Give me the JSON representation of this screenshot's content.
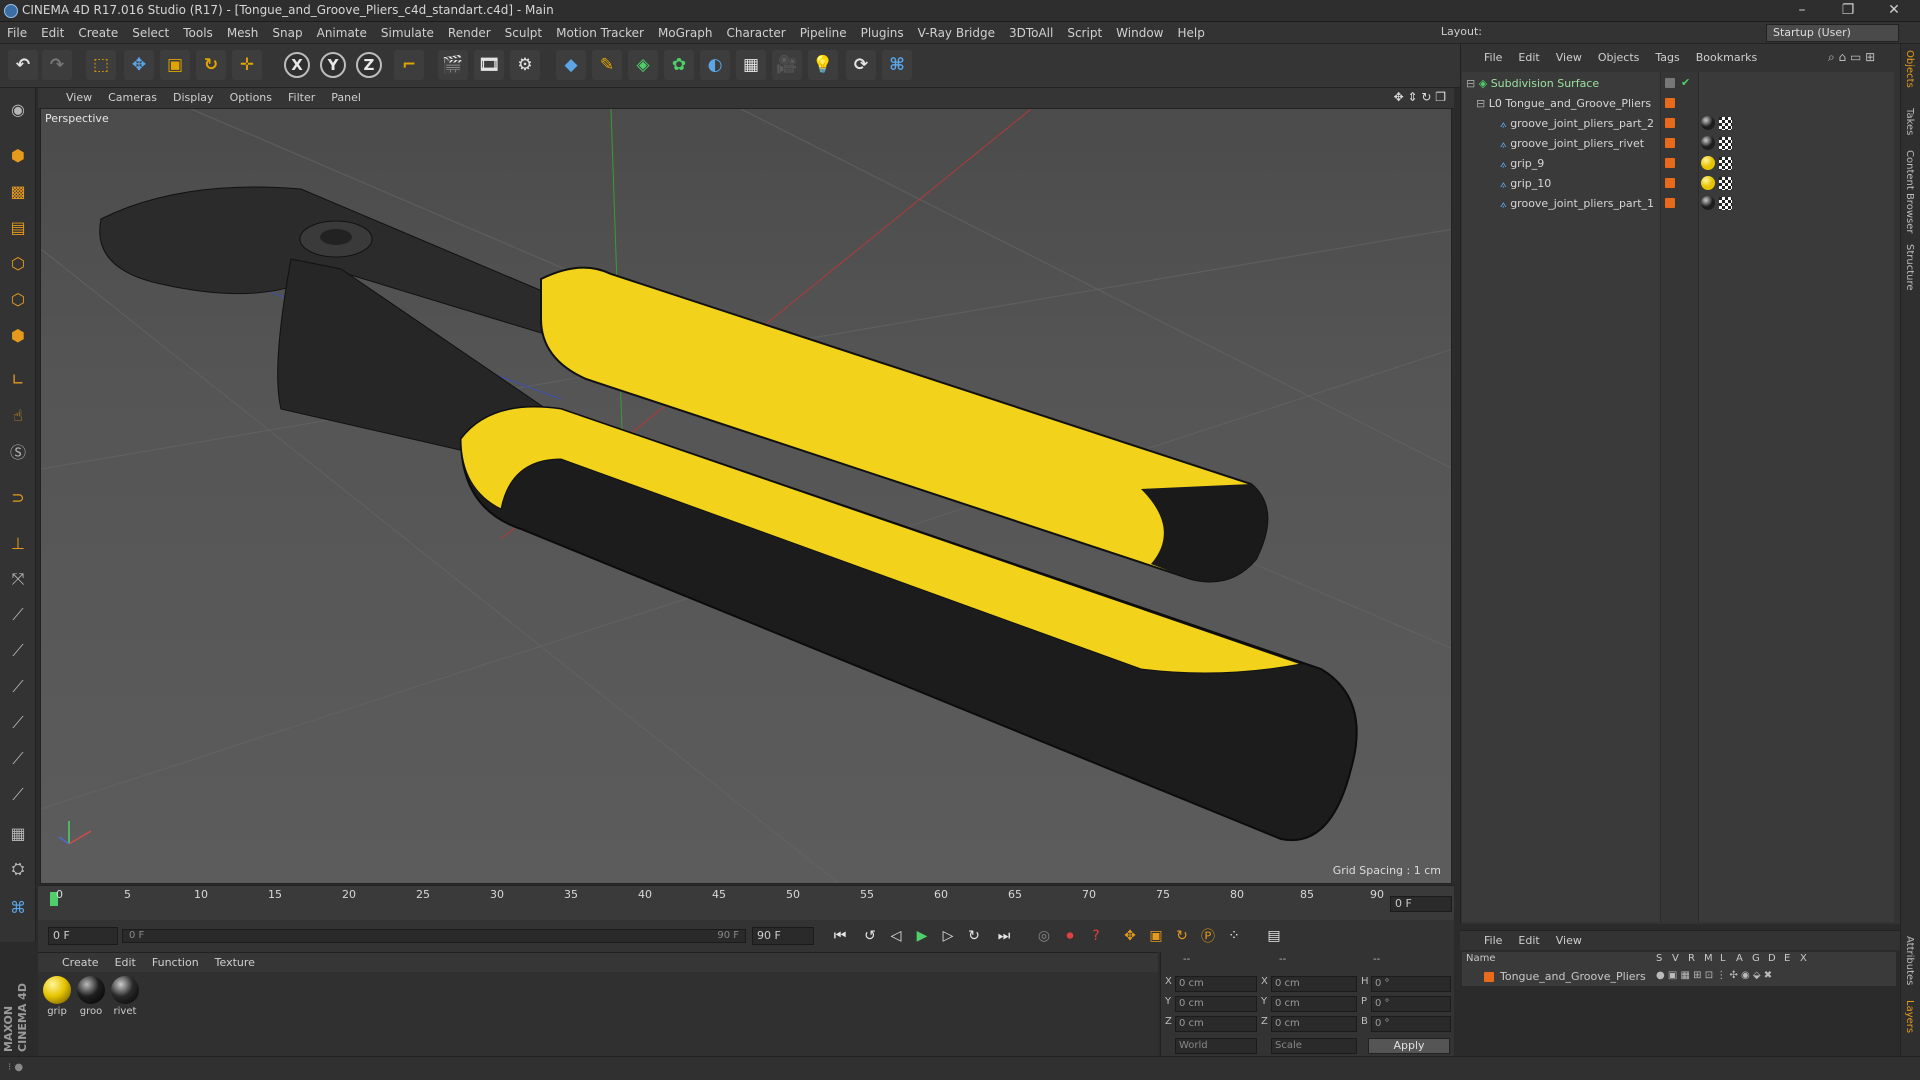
{
  "window": {
    "title": "CINEMA 4D R17.016 Studio (R17) - [Tongue_and_Groove_Pliers_c4d_standart.c4d] - Main",
    "minimize": "–",
    "maximize": "❐",
    "close": "✕"
  },
  "menubar": [
    "File",
    "Edit",
    "Create",
    "Select",
    "Tools",
    "Mesh",
    "Snap",
    "Animate",
    "Simulate",
    "Render",
    "Sculpt",
    "Motion Tracker",
    "MoGraph",
    "Character",
    "Pipeline",
    "Plugins",
    "V-Ray Bridge",
    "3DToAll",
    "Script",
    "Window",
    "Help"
  ],
  "layout": {
    "label": "Layout:",
    "value": "Startup (User)"
  },
  "viewport": {
    "menu": [
      "View",
      "Cameras",
      "Display",
      "Options",
      "Filter",
      "Panel"
    ],
    "camera_label": "Perspective",
    "grid_spacing": "Grid Spacing : 1 cm"
  },
  "timeline": {
    "ticks": [
      "0",
      "5",
      "10",
      "15",
      "20",
      "25",
      "30",
      "35",
      "40",
      "45",
      "50",
      "55",
      "60",
      "65",
      "70",
      "75",
      "80",
      "85",
      "90"
    ],
    "end_frame_field": "0 F",
    "start_field": "0 F",
    "range_start": "0 F",
    "range_end": "90 F",
    "end_field": "90 F"
  },
  "material_manager": {
    "menu": [
      "Create",
      "Edit",
      "Function",
      "Texture"
    ],
    "materials": [
      {
        "name": "grip",
        "color": "#e6c400"
      },
      {
        "name": "groo",
        "color": "#1e1e1e"
      },
      {
        "name": "rivet",
        "color": "#2a2a2a"
      }
    ]
  },
  "coordinates": {
    "header": [
      "--",
      "--",
      "--"
    ],
    "rows": [
      {
        "a": "X",
        "a_val": "0 cm",
        "b": "X",
        "b_val": "0 cm",
        "c": "H",
        "c_val": "0 °"
      },
      {
        "a": "Y",
        "a_val": "0 cm",
        "b": "Y",
        "b_val": "0 cm",
        "c": "P",
        "c_val": "0 °"
      },
      {
        "a": "Z",
        "a_val": "0 cm",
        "b": "Z",
        "b_val": "0 cm",
        "c": "B",
        "c_val": "0 °"
      }
    ],
    "world": "World",
    "scale": "Scale",
    "apply": "Apply"
  },
  "object_manager": {
    "menu": [
      "File",
      "Edit",
      "View",
      "Objects",
      "Tags",
      "Bookmarks"
    ],
    "objects": [
      {
        "name": "Subdivision Surface",
        "indent": 0,
        "tag": "none"
      },
      {
        "name": "Tongue_and_Groove_Pliers",
        "indent": 1,
        "tag": "none"
      },
      {
        "name": "groove_joint_pliers_part_2",
        "indent": 2,
        "tag": "dark"
      },
      {
        "name": "groove_joint_pliers_rivet",
        "indent": 2,
        "tag": "dark"
      },
      {
        "name": "grip_9",
        "indent": 2,
        "tag": "yellow"
      },
      {
        "name": "grip_10",
        "indent": 2,
        "tag": "yellow"
      },
      {
        "name": "groove_joint_pliers_part_1",
        "indent": 2,
        "tag": "dark"
      }
    ]
  },
  "layers_panel": {
    "menu": [
      "File",
      "Edit",
      "View"
    ],
    "columns": [
      "Name",
      "S",
      "V",
      "R",
      "M",
      "L",
      "A",
      "G",
      "D",
      "E",
      "X"
    ],
    "row_name": "Tongue_and_Groove_Pliers"
  },
  "right_tabs": [
    "Objects",
    "Takes",
    "Content Browser",
    "Structure",
    "Attributes",
    "Layers"
  ],
  "branding": "MAXON CINEMA 4D",
  "colors": {
    "accent": "#e59a1c",
    "grip_yellow": "#f2d21a",
    "selection_green": "#9ce0a0"
  }
}
